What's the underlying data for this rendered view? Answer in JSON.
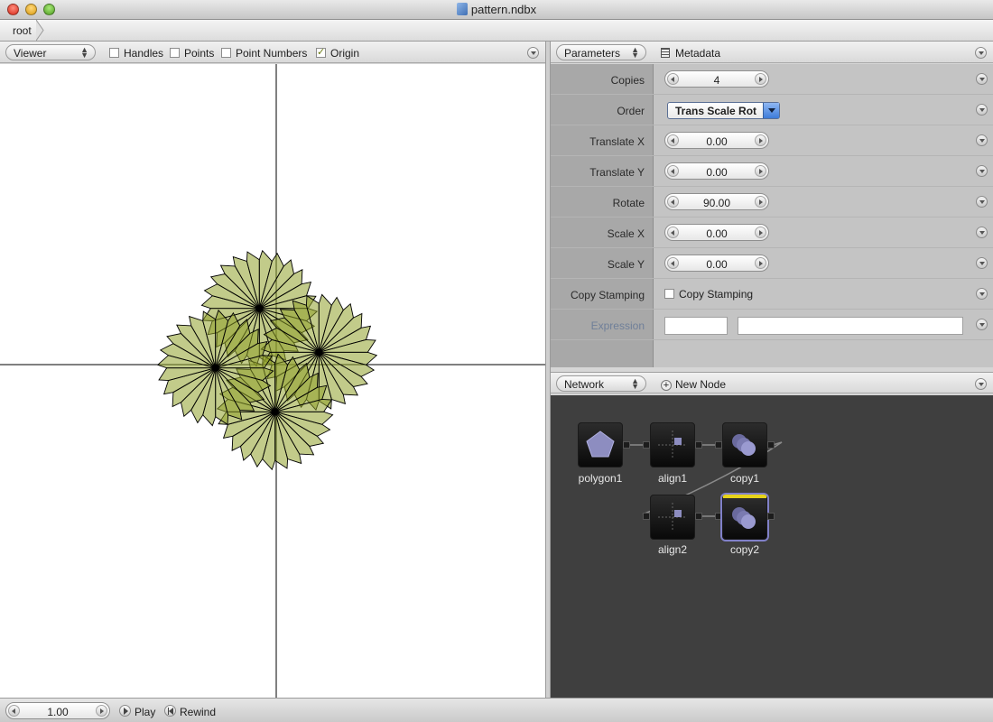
{
  "window": {
    "title": "pattern.ndbx"
  },
  "breadcrumb": {
    "items": [
      "root"
    ]
  },
  "viewer": {
    "mode_label": "Viewer",
    "toggles": [
      {
        "label": "Handles",
        "checked": false
      },
      {
        "label": "Points",
        "checked": false
      },
      {
        "label": "Point Numbers",
        "checked": false
      },
      {
        "label": "Origin",
        "checked": true
      }
    ],
    "shape_color": "#8fa02a"
  },
  "parameters": {
    "tab_label": "Parameters",
    "metadata_label": "Metadata",
    "rows": {
      "copies": {
        "label": "Copies",
        "value": "4"
      },
      "order": {
        "label": "Order",
        "value": "Trans Scale Rot"
      },
      "translate_x": {
        "label": "Translate X",
        "value": "0.00"
      },
      "translate_y": {
        "label": "Translate Y",
        "value": "0.00"
      },
      "rotate": {
        "label": "Rotate",
        "value": "90.00"
      },
      "scale_x": {
        "label": "Scale X",
        "value": "0.00"
      },
      "scale_y": {
        "label": "Scale Y",
        "value": "0.00"
      },
      "copy_stamping": {
        "label": "Copy Stamping",
        "checkbox_label": "Copy Stamping",
        "checked": false
      },
      "expression": {
        "label": "Expression"
      }
    }
  },
  "network": {
    "tab_label": "Network",
    "new_node_label": "New Node",
    "nodes": [
      {
        "name": "polygon1",
        "icon": "pentagon-icon"
      },
      {
        "name": "align1",
        "icon": "align-icon"
      },
      {
        "name": "copy1",
        "icon": "copy-icon"
      },
      {
        "name": "align2",
        "icon": "align-icon"
      },
      {
        "name": "copy2",
        "icon": "copy-icon",
        "selected": true
      }
    ]
  },
  "playback": {
    "frame": "1.00",
    "play_label": "Play",
    "rewind_label": "Rewind"
  }
}
